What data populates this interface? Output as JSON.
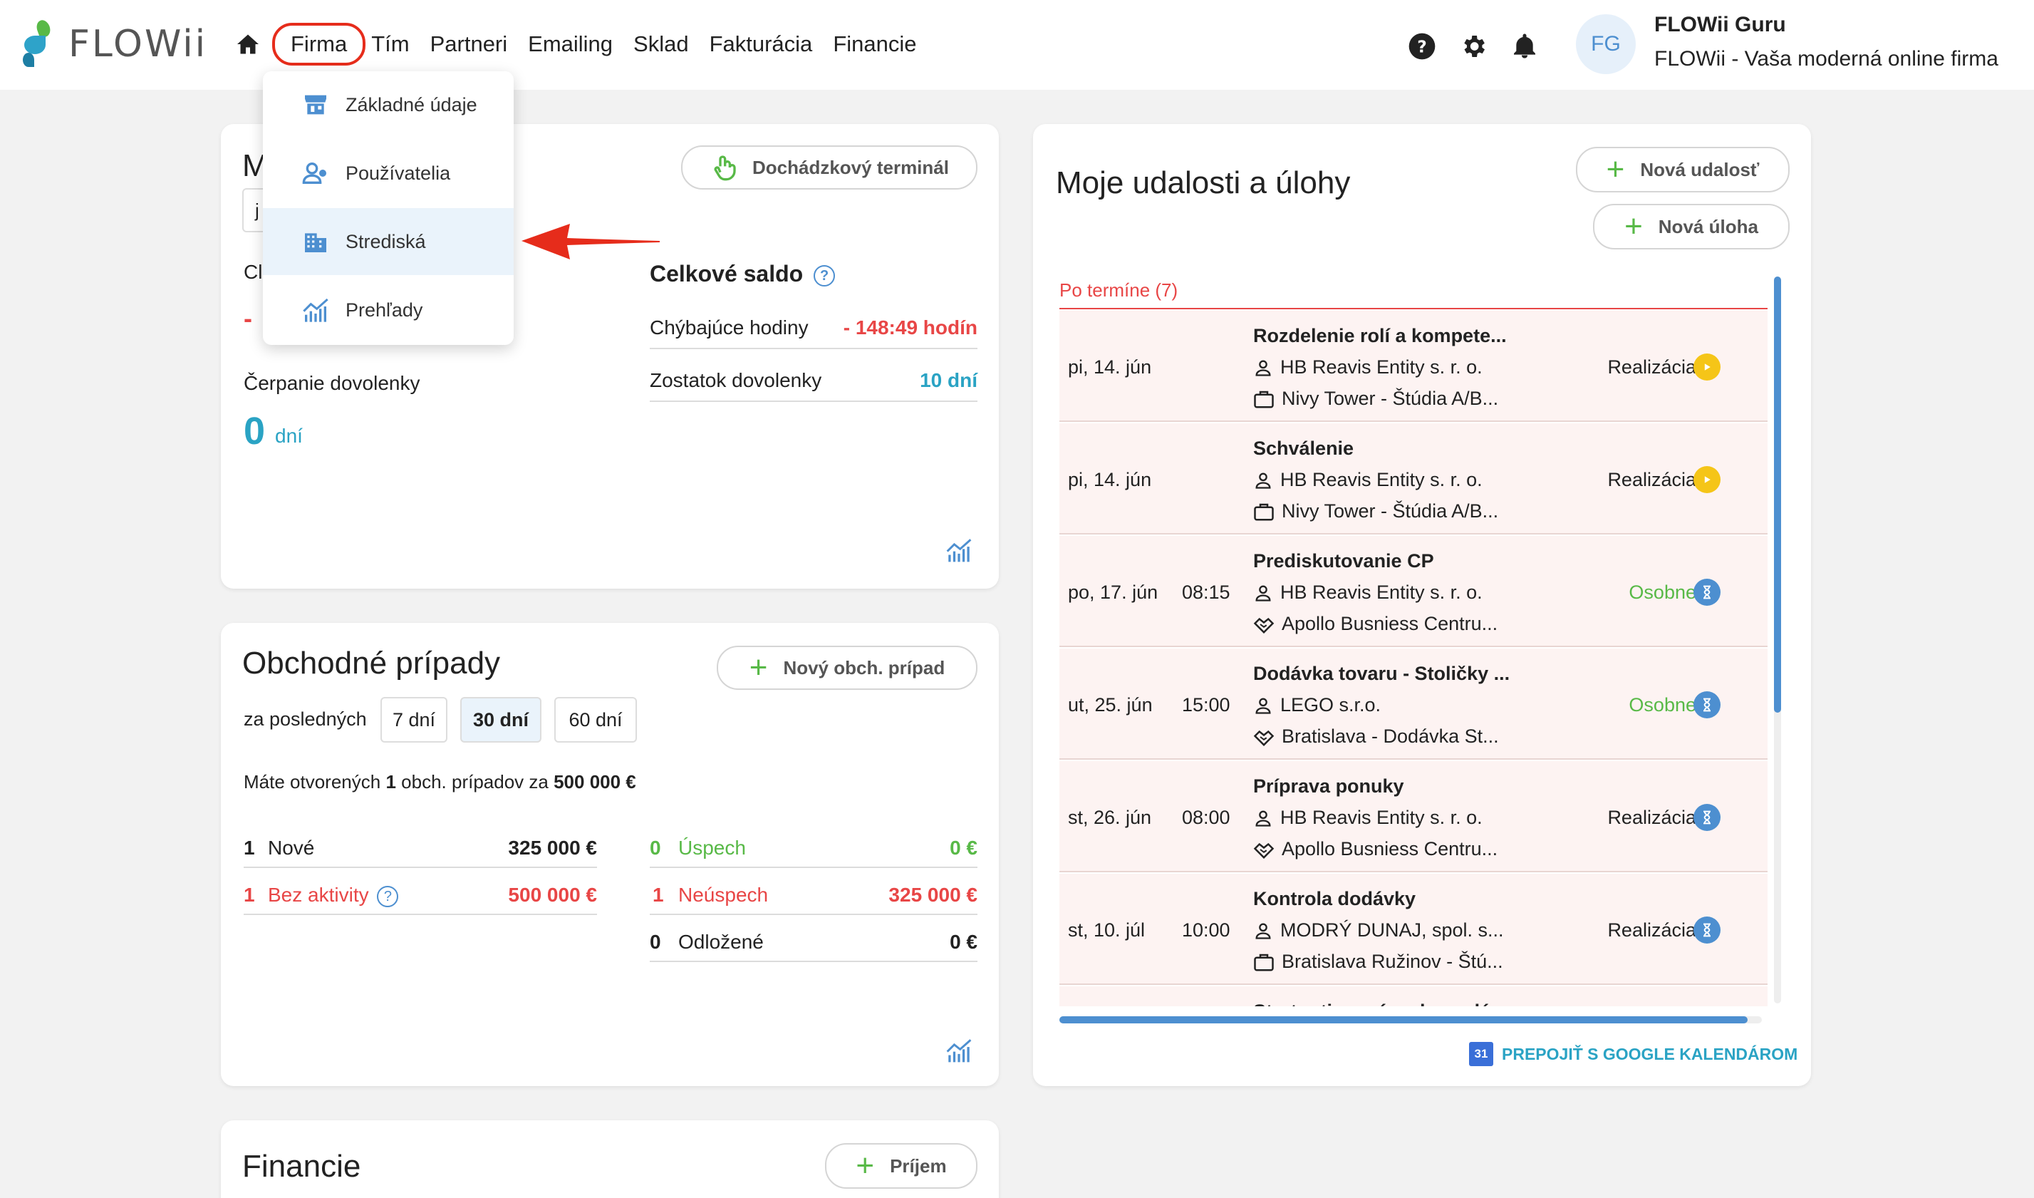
{
  "header": {
    "logo_text": "FLOWii",
    "nav": [
      "Firma",
      "Tím",
      "Partneri",
      "Emailing",
      "Sklad",
      "Fakturácia",
      "Financie"
    ],
    "user_initials": "FG",
    "user_name": "FLOWii Guru",
    "user_company": "FLOWii - Vaša moderná online firma"
  },
  "dropdown": {
    "items": [
      "Základné údaje",
      "Používatelia",
      "Strediská",
      "Prehľady"
    ]
  },
  "attendance": {
    "title_partial": "M",
    "input_partial": "j",
    "label_partial": "Cl",
    "value_partial": "-",
    "terminal_button": "Dochádzkový terminál",
    "celkove_saldo": "Celkové saldo",
    "chybajuce_label": "Chýbajúce hodiny",
    "chybajuce_value": "- 148:49 hodín",
    "zostatok_label": "Zostatok dovolenky",
    "zostatok_value": "10 dní",
    "cerpanie_label": "Čerpanie dovolenky",
    "cerpanie_value": "0",
    "cerpanie_unit": "dní"
  },
  "deals": {
    "title": "Obchodné prípady",
    "new_button": "Nový obch. prípad",
    "period_label": "za posledných",
    "periods": [
      "7 dní",
      "30 dní",
      "60 dní"
    ],
    "summary_prefix": "Máte otvorených",
    "summary_count": "1",
    "summary_mid": "obch. prípadov za",
    "summary_amount": "500 000 €",
    "rows_left": [
      {
        "count": "1",
        "label": "Nové",
        "amount": "325 000 €"
      },
      {
        "count": "1",
        "label": "Bez aktivity",
        "amount": "500 000 €"
      }
    ],
    "rows_right": [
      {
        "count": "0",
        "label": "Úspech",
        "amount": "0 €"
      },
      {
        "count": "1",
        "label": "Neúspech",
        "amount": "325 000 €"
      },
      {
        "count": "0",
        "label": "Odložené",
        "amount": "0 €"
      }
    ]
  },
  "finance": {
    "title": "Financie",
    "prijem_button": "Príjem"
  },
  "events": {
    "title": "Moje udalosti a úlohy",
    "new_event": "Nová udalosť",
    "new_task": "Nová úloha",
    "overdue": "Po termíne (7)",
    "items": [
      {
        "date": "pi, 14. jún",
        "time": "",
        "title": "Rozdelenie rolí a kompete...",
        "sub1": "HB Reavis Entity s. r. o.",
        "sub2": "Nivy Tower - Štúdia A/B...",
        "sub2_icon": "briefcase",
        "status": "Realizácia",
        "status_type": "play"
      },
      {
        "date": "pi, 14. jún",
        "time": "",
        "title": "Schválenie",
        "sub1": "HB Reavis Entity s. r. o.",
        "sub2": "Nivy Tower - Štúdia A/B...",
        "sub2_icon": "briefcase",
        "status": "Realizácia",
        "status_type": "play"
      },
      {
        "date": "po, 17. jún",
        "time": "08:15",
        "title": "Prediskutovanie CP",
        "sub1": "HB Reavis Entity s. r. o.",
        "sub2": "Apollo Busniess Centru...",
        "sub2_icon": "handshake",
        "status": "Osobne",
        "status_type": "hourglass"
      },
      {
        "date": "ut, 25. jún",
        "time": "15:00",
        "title": "Dodávka tovaru - Stoličky ...",
        "sub1": "LEGO s.r.o.",
        "sub2": "Bratislava - Dodávka St...",
        "sub2_icon": "handshake",
        "status": "Osobne",
        "status_type": "hourglass"
      },
      {
        "date": "st, 26. jún",
        "time": "08:00",
        "title": "Príprava ponuky",
        "sub1": "HB Reavis Entity s. r. o.",
        "sub2": "Apollo Busniess Centru...",
        "sub2_icon": "handshake",
        "status": "Realizácia",
        "status_type": "hourglass"
      },
      {
        "date": "st, 10. júl",
        "time": "10:00",
        "title": "Kontrola dodávky",
        "sub1": "MODRÝ DUNAJ, spol. s...",
        "sub2": "Bratislava Ružinov - Štú...",
        "sub2_icon": "briefcase",
        "status": "Realizácia",
        "status_type": "hourglass"
      },
      {
        "date": "",
        "time": "",
        "title": "Stretnutie u nás v kancelá...",
        "sub1": "",
        "sub2": "",
        "sub2_icon": "",
        "status": "",
        "status_type": ""
      }
    ],
    "gcal_badge": "31",
    "gcal_link": "PREPOJIŤ S GOOGLE KALENDÁROM"
  },
  "colors": {
    "accent_blue": "#4d8fd0",
    "green": "#58b947",
    "red": "#e84646",
    "teal": "#2aa3c4",
    "yellow": "#f5c518"
  }
}
